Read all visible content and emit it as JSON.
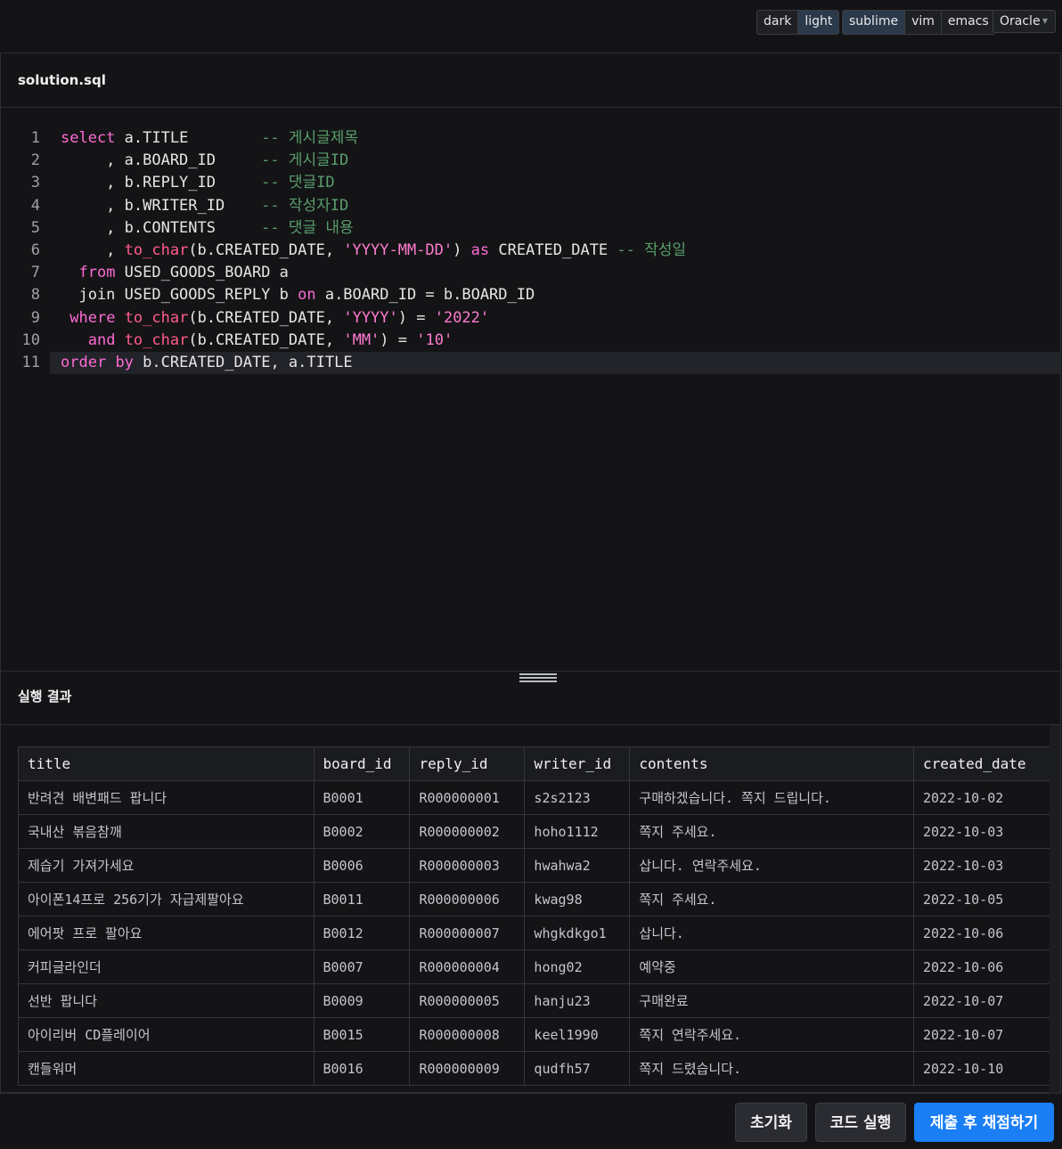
{
  "toolbar": {
    "themes": [
      "dark",
      "light"
    ],
    "keymaps": [
      "sublime",
      "vim",
      "emacs"
    ],
    "language": "Oracle"
  },
  "editor": {
    "filename": "solution.sql",
    "lines": [
      {
        "n": "1"
      },
      {
        "n": "2"
      },
      {
        "n": "3"
      },
      {
        "n": "4"
      },
      {
        "n": "5"
      },
      {
        "n": "6"
      },
      {
        "n": "7"
      },
      {
        "n": "8"
      },
      {
        "n": "9"
      },
      {
        "n": "10"
      },
      {
        "n": "11"
      }
    ]
  },
  "result": {
    "title": "실행 결과",
    "columns": [
      "title",
      "board_id",
      "reply_id",
      "writer_id",
      "contents",
      "created_date"
    ],
    "rows": [
      [
        "반려견 배변패드 팝니다",
        "B0001",
        "R000000001",
        "s2s2123",
        "구매하겠습니다. 쪽지 드립니다.",
        "2022-10-02"
      ],
      [
        "국내산 볶음참깨",
        "B0002",
        "R000000002",
        "hoho1112",
        "쪽지 주세요.",
        "2022-10-03"
      ],
      [
        "제습기 가져가세요",
        "B0006",
        "R000000003",
        "hwahwa2",
        "삽니다. 연락주세요.",
        "2022-10-03"
      ],
      [
        "아이폰14프로 256기가 자급제팔아요",
        "B0011",
        "R000000006",
        "kwag98",
        "쪽지 주세요.",
        "2022-10-05"
      ],
      [
        "에어팟 프로 팔아요",
        "B0012",
        "R000000007",
        "whgkdkgo1",
        "삽니다.",
        "2022-10-06"
      ],
      [
        "커피글라인더",
        "B0007",
        "R000000004",
        "hong02",
        "예약중",
        "2022-10-06"
      ],
      [
        "선반 팝니다",
        "B0009",
        "R000000005",
        "hanju23",
        "구매완료",
        "2022-10-07"
      ],
      [
        "아이리버 CD플레이어",
        "B0015",
        "R000000008",
        "keel1990",
        "쪽지 연락주세요.",
        "2022-10-07"
      ],
      [
        "캔들워머",
        "B0016",
        "R000000009",
        "qudfh57",
        "쪽지 드렸습니다.",
        "2022-10-10"
      ]
    ]
  },
  "footer": {
    "reset": "초기화",
    "run": "코드 실행",
    "submit": "제출 후 채점하기"
  }
}
